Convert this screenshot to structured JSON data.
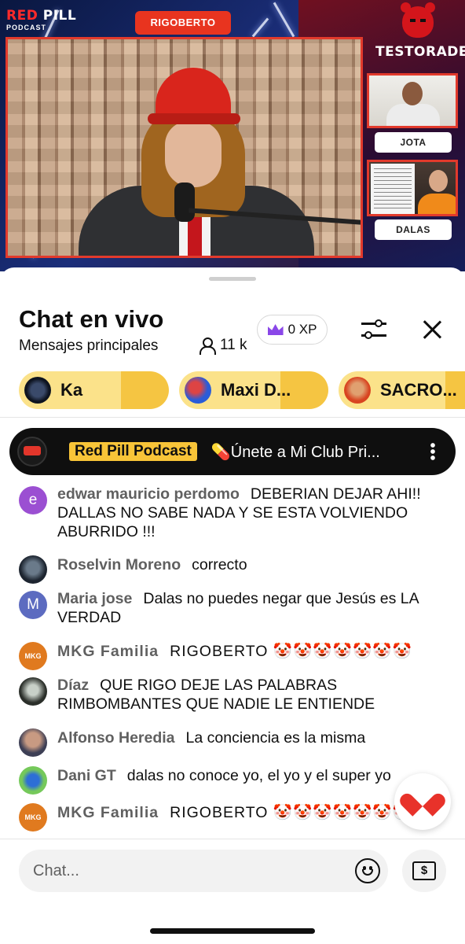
{
  "video": {
    "logo_left_red": "RED",
    "logo_left_white": "PILL",
    "logo_left_sub": "PODCAST",
    "speaker_tag": "RIGOBERTO",
    "logo_right": "TESTORADE",
    "cam1_label": "JOTA",
    "cam2_label": "DALAS"
  },
  "header": {
    "title": "Chat en vivo",
    "subtitle": "Mensajes principales",
    "viewers": "11 k",
    "xp": "0 XP"
  },
  "chips": [
    {
      "name": "Ka"
    },
    {
      "name": "Maxi D..."
    },
    {
      "name": "SACRO..."
    }
  ],
  "pinned": {
    "tag": "Red Pill Podcast",
    "message": "💊Únete a Mi Club Pri..."
  },
  "messages": [
    {
      "author": "edwar mauricio perdomo",
      "text": "DEBERIAN DEJAR AHI!! DALLAS NO SABE NADA Y SE ESTA VOLVIENDO ABURRIDO !!!",
      "avatar_letter": "e"
    },
    {
      "author": "Roselvin Moreno",
      "text": "correcto"
    },
    {
      "author": "Maria jose",
      "text": "Dalas no puedes negar que Jesús es LA VERDAD",
      "avatar_letter": "M"
    },
    {
      "author": "MKG Familia",
      "text": "RIGOBERTO 🤡🤡🤡🤡🤡🤡🤡",
      "avatar_text": "MKG"
    },
    {
      "author": "Díaz",
      "text": "QUE RIGO DEJE LAS PALABRAS RIMBOMBANTES QUE NADIE LE ENTIENDE"
    },
    {
      "author": "Alfonso Heredia",
      "text": "La conciencia es la misma"
    },
    {
      "author": "Dani GT",
      "text": "dalas no conoce yo, el yo y el super yo"
    },
    {
      "author": "MKG Familia",
      "text": "RIGOBERTO 🤡🤡🤡🤡🤡🤡🤡",
      "avatar_text": "MKG"
    }
  ],
  "input": {
    "placeholder": "Chat..."
  },
  "colors": {
    "accent_red": "#e23a2c",
    "chip_gold": "#f5c542",
    "pinned_tag": "#f8c438",
    "xp_crown": "#8a47e8"
  }
}
